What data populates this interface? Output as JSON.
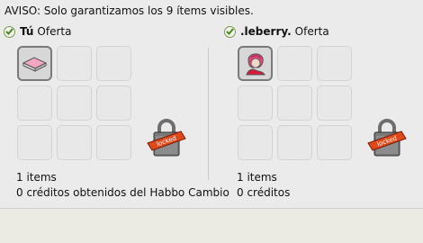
{
  "warning": "AVISO: Solo garantizamos los 9 ítems visibles.",
  "left": {
    "name": "Tú",
    "status": "Oferta",
    "items_count": "1 items",
    "credits": "0 créditos obtenidos del Habbo Cambio",
    "lock_icon": "locked-sign-icon"
  },
  "right": {
    "name": ".leberry.",
    "status": "Oferta",
    "items_count": "1 items",
    "credits": "0 créditos",
    "lock_icon": "locked-sign-icon"
  },
  "colors": {
    "accept_check": "#4a8a1a",
    "lock_tag": "#e04a1a"
  }
}
